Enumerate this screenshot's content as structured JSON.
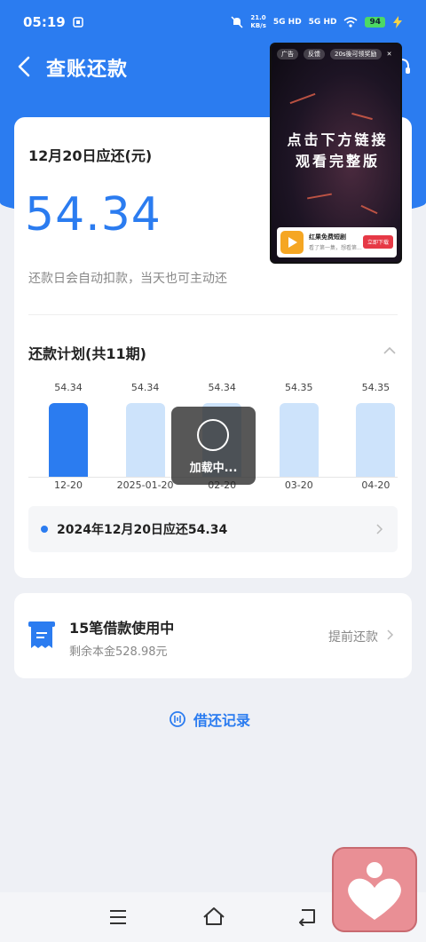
{
  "status_bar": {
    "time": "05:19",
    "net_speed": "21.0",
    "net_unit": "KB/s",
    "sim1": "5G HD",
    "sim2": "5G HD",
    "battery": "94"
  },
  "header": {
    "title": "查账还款"
  },
  "due": {
    "label": "12月20日应还(元)",
    "amount": "54.34",
    "auto_note": "还款日会自动扣款，当天也可主动还"
  },
  "plan": {
    "title": "还款计划(共11期)"
  },
  "chart_data": {
    "type": "bar",
    "categories": [
      "12-20",
      "2025-01-20",
      "02-20",
      "03-20",
      "04-20"
    ],
    "values": [
      54.34,
      54.34,
      54.34,
      54.35,
      54.35
    ],
    "value_labels": [
      "54.34",
      "54.34",
      "54.34",
      "54.35",
      "54.35"
    ],
    "highlight_index": 0,
    "colors": {
      "active": "#2b7cf0",
      "inactive": "#cde3fb"
    }
  },
  "next_payment": {
    "text": "2024年12月20日应还54.34"
  },
  "loans": {
    "title": "15笔借款使用中",
    "remaining": "剩余本金528.98元",
    "prepay_label": "提前还款"
  },
  "history_link": "借还记录",
  "loading": {
    "text": "加载中..."
  },
  "ad": {
    "tag": "广告",
    "feedback": "反馈",
    "reward": "20s後可领奖励",
    "headline_line1": "点击下方链接",
    "headline_line2": "观看完整版",
    "app_name": "红果免费短剧",
    "app_desc": "看了第一集，想看第...",
    "cta": "立即下载"
  },
  "colors": {
    "primary": "#2b7cf0",
    "background": "#eef0f5"
  }
}
